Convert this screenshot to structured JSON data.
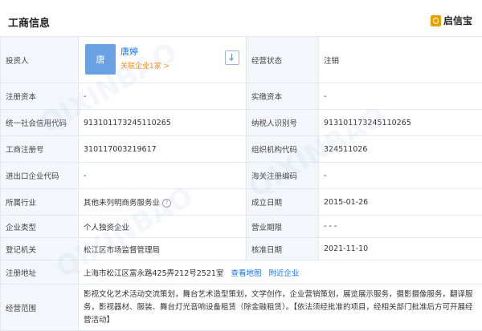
{
  "header": {
    "title": "工商信息",
    "brand": "启信宝"
  },
  "investor": {
    "label": "投资人",
    "avatar_char": "唐",
    "name": "唐婷",
    "related": "关联企业1家 >",
    "status_label": "经营状态",
    "status_value": "注销"
  },
  "rows": [
    {
      "l1": "注册资本",
      "v1": "-",
      "l2": "实缴资本",
      "v2": "-"
    },
    {
      "l1": "统一社会信用代码",
      "v1": "91310117324511026​5",
      "l2": "纳税人识别号",
      "v2": "913101173245110265"
    },
    {
      "l1": "工商注册号",
      "v1": "310117003219617",
      "l2": "组织机构代码",
      "v2": "324511026"
    },
    {
      "l1": "进出口企业代码",
      "v1": "-",
      "l2": "海关注册编码",
      "v2": "-"
    },
    {
      "l1": "所属行业",
      "v1": "其他未列明商务服务业",
      "l2": "成立日期",
      "v2": "2015-01-26"
    },
    {
      "l1": "企业类型",
      "v1": "个人独资企业",
      "l2": "营业期限",
      "v2": "- - -"
    },
    {
      "l1": "登记机关",
      "v1": "松江区市场监督管理局",
      "l2": "核准日期",
      "v2": "2021-11-10"
    }
  ],
  "address": {
    "label": "注册地址",
    "value": "上海市松江区富永路425弄212号2521室",
    "map_link": "查看地图",
    "nearby_link": "附近企业"
  },
  "scope": {
    "label": "经营范围",
    "value": "影视文化艺术活动交流策划，舞台艺术造型策划，文学创作，企业营销策划，展览展示服务，摄影摄像服务，翻译服务，影视器材、服装、舞台灯光音响设备租赁（除金融租赁）。【依法须经批准的项目，经相关部门批准后方可开展经营活动】"
  }
}
